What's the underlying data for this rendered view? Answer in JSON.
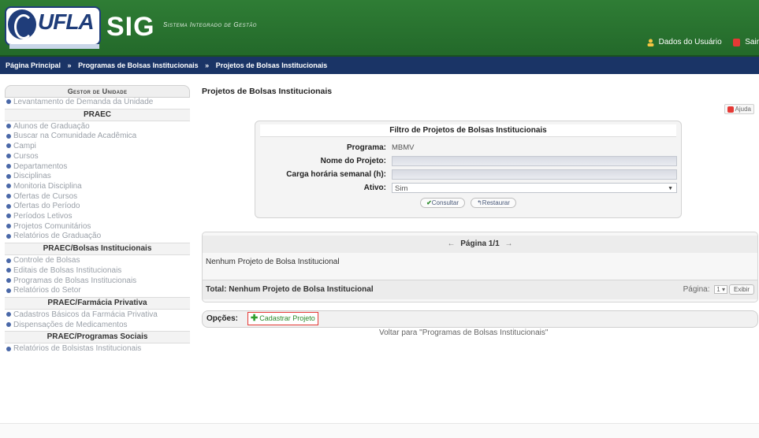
{
  "header": {
    "logo_text": "UFLA",
    "app_name": "SIG",
    "app_subtitle": "Sistema Integrado de Gestão",
    "user_link": "Dados do Usuário",
    "exit_link": "Sair"
  },
  "breadcrumb": [
    "Página Principal",
    "Programas de Bolsas Institucionais",
    "Projetos de Bolsas Institucionais"
  ],
  "breadcrumb_sep": "»",
  "sidebar": {
    "title": "Gestor de Unidade",
    "groups": [
      {
        "heading": "",
        "items": [
          "Levantamento de Demanda da Unidade"
        ]
      },
      {
        "heading": "PRAEC",
        "items": [
          "Alunos de Graduação",
          "Buscar na Comunidade Acadêmica",
          "Campi",
          "Cursos",
          "Departamentos",
          "Disciplinas",
          "Monitoria Disciplina",
          "Ofertas de Cursos",
          "Ofertas do Período",
          "Períodos Letivos",
          "Projetos Comunitários",
          "Relatórios de Graduação"
        ]
      },
      {
        "heading": "PRAEC/Bolsas Institucionais",
        "items": [
          "Controle de Bolsas",
          "Editais de Bolsas Institucionais",
          "Programas de Bolsas Institucionais",
          "Relatórios do Setor"
        ]
      },
      {
        "heading": "PRAEC/Farmácia Privativa",
        "items": [
          "Cadastros Básicos da Farmácia Privativa",
          "Dispensações de Medicamentos"
        ]
      },
      {
        "heading": "PRAEC/Programas Sociais",
        "items": [
          "Relatórios de Bolsistas Institucionais"
        ]
      }
    ]
  },
  "main": {
    "title": "Projetos de Bolsas Institucionais",
    "help": "Ajuda"
  },
  "filter": {
    "title": "Filtro de Projetos de Bolsas Institucionais",
    "programa_label": "Programa:",
    "programa_value": "MBMV",
    "nome_label": "Nome do Projeto:",
    "nome_value": "",
    "carga_label": "Carga horária semanal (h):",
    "carga_value": "",
    "ativo_label": "Ativo:",
    "ativo_value": "Sim",
    "consultar": "Consultar",
    "restaurar": "Restaurar"
  },
  "results": {
    "pager": "Página 1/1",
    "prev": "←",
    "next": "→",
    "empty_message": "Nenhum Projeto de Bolsa Institucional",
    "total": "Total: Nenhum Projeto de Bolsa Institucional",
    "page_label": "Página:",
    "page_value": "1",
    "exibir": "Exibir"
  },
  "options": {
    "label": "Opções:",
    "cadastrar": "Cadastrar Projeto"
  },
  "voltar": "Voltar para \"Programas de Bolsas Institucionais\"",
  "colors": {
    "header_green": "#2f7d35",
    "breadcrumb_blue": "#1a3466",
    "highlight_red": "#e53935"
  }
}
